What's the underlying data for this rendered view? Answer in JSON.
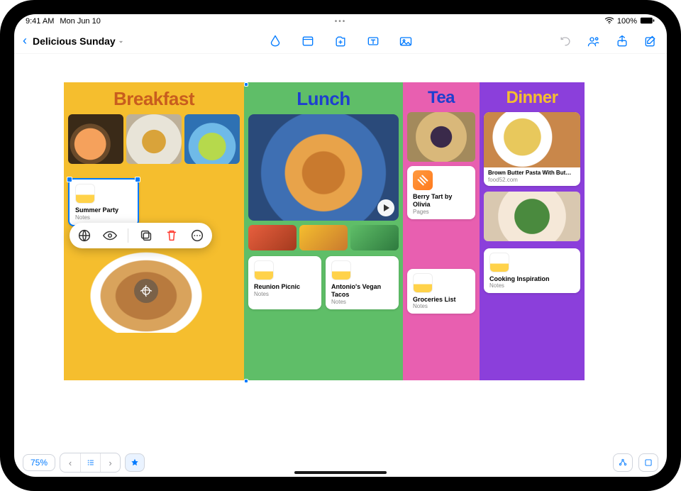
{
  "status": {
    "time": "9:41 AM",
    "date": "Mon Jun 10",
    "battery": "100%"
  },
  "toolbar": {
    "back_label": "",
    "doc_title": "Delicious Sunday"
  },
  "columns": {
    "breakfast": {
      "title": "Breakfast"
    },
    "lunch": {
      "title": "Lunch"
    },
    "tea": {
      "title": "Tea"
    },
    "dinner": {
      "title": "Dinner"
    }
  },
  "cards": {
    "summer_party": {
      "title": "Summer Party",
      "sub": "Notes"
    },
    "reunion_picnic": {
      "title": "Reunion Picnic",
      "sub": "Notes"
    },
    "vegan_tacos": {
      "title": "Antonio's Vegan Tacos",
      "sub": "Notes"
    },
    "berry_tart": {
      "title": "Berry Tart by Olivia",
      "sub": "Pages"
    },
    "groceries": {
      "title": "Groceries List",
      "sub": "Notes"
    },
    "pasta_link": {
      "title": "Brown Butter Pasta With But…",
      "sub": "food52.com"
    },
    "cooking_insp": {
      "title": "Cooking Inspiration",
      "sub": "Notes"
    }
  },
  "bottom": {
    "zoom": "75%"
  }
}
